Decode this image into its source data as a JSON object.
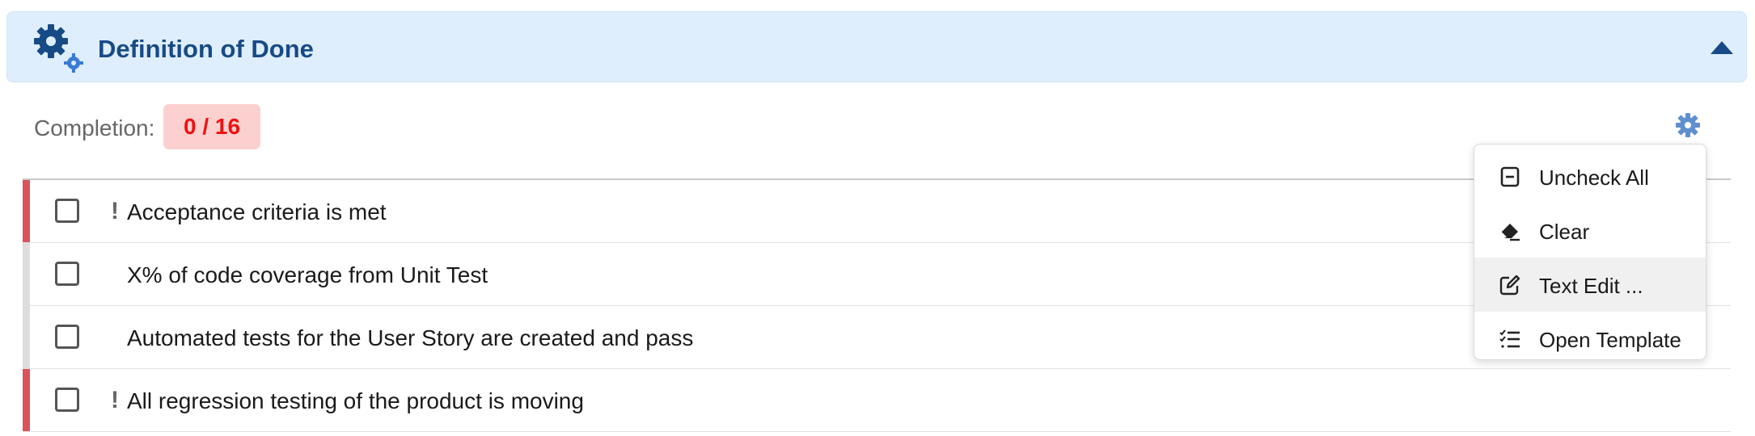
{
  "header": {
    "title": "Definition of Done"
  },
  "completion": {
    "label": "Completion:",
    "value": "0 / 16"
  },
  "checklist": [
    {
      "text": "Acceptance criteria is met",
      "required": true,
      "checked": false
    },
    {
      "text": "X% of code coverage from Unit Test",
      "required": false,
      "checked": false
    },
    {
      "text": "Automated tests for the User Story are created and pass",
      "required": false,
      "checked": false
    },
    {
      "text": "All regression testing of the product is moving",
      "required": true,
      "checked": false
    }
  ],
  "menu": {
    "items": [
      {
        "label": "Uncheck All",
        "icon": "minus-square-icon"
      },
      {
        "label": "Clear",
        "icon": "eraser-icon"
      },
      {
        "label": "Text Edit ...",
        "icon": "edit-icon"
      },
      {
        "label": "Open Template",
        "icon": "checklist-icon"
      }
    ]
  },
  "colors": {
    "header_bg": "#dfeefc",
    "title": "#174b86",
    "badge_bg": "#fcd0cf",
    "badge_text": "#ee1111",
    "required_stripe": "#d9545a",
    "optional_stripe": "#dddddd"
  }
}
